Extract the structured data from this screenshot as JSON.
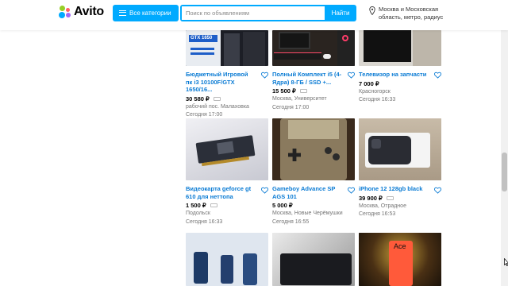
{
  "header": {
    "logo_text": "Avito",
    "categories_label": "Все категории",
    "search_placeholder": "Поиск по объявлениям",
    "search_button": "Найти",
    "location_line1": "Москва и Московская",
    "location_line2": "область, метро, радиус"
  },
  "colors": {
    "accent": "#00aaff",
    "title_link": "#0a7bd4",
    "logo_dots": [
      "#97cf26",
      "#ff6163",
      "#0af",
      "#a169f7"
    ]
  },
  "listings": [
    {
      "title": "Бюджетный Игровой пк i3 10100F/GTX 1650/16...",
      "price": "30 580 ₽",
      "location": "рабочий пос. Малаховка",
      "date": "Сегодня 17:00",
      "photo_label": "GTX 1650"
    },
    {
      "title": "Полный Комплект i5 (4-Ядра) 8-ГБ / SSD +...",
      "price": "15 500 ₽",
      "location": "Москва, Университет",
      "date": "Сегодня 17:00"
    },
    {
      "title": "Телевизор на запчасти",
      "price": "7 000 ₽",
      "location": "Красногорск",
      "date": "Сегодня 16:33"
    },
    {
      "title": "Видеокарта geforce gt 610 для неттопа",
      "price": "1 500 ₽",
      "location": "Подольск",
      "date": "Сегодня 16:33"
    },
    {
      "title": "Gameboy Advance SP AGS 101",
      "price": "5 000 ₽",
      "location": "Москва, Новые Черёмушки",
      "date": "Сегодня 16:55"
    },
    {
      "title": "iPhone 12 128gb black",
      "price": "39 900 ₽",
      "location": "Москва, Отрадное",
      "date": "Сегодня 16:53"
    },
    {
      "title": "",
      "price": "",
      "location": "",
      "date": ""
    },
    {
      "title": "",
      "price": "",
      "location": "",
      "date": ""
    },
    {
      "title": "",
      "price": "",
      "location": "",
      "date": "",
      "photo_label": "Ace"
    }
  ]
}
